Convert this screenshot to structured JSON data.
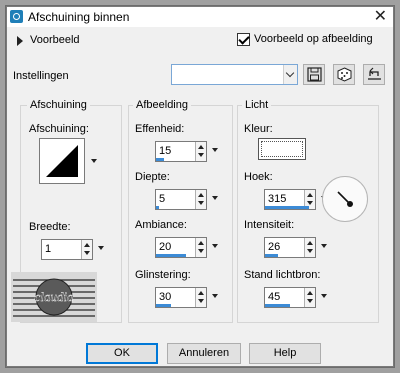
{
  "window": {
    "title": "Afschuining binnen",
    "close_symbol": "✕"
  },
  "preview": {
    "label": "Voorbeeld",
    "on_image_label": "Voorbeeld op afbeelding",
    "on_image_checked": true
  },
  "settings": {
    "label": "Instellingen",
    "value": ""
  },
  "bevel_group": {
    "title": "Afschuining",
    "shape_label": "Afschuining:",
    "width_label": "Breedte:",
    "width_value": "1"
  },
  "image_group": {
    "title": "Afbeelding",
    "smoothness": {
      "label": "Effenheid:",
      "value": "15",
      "level": 0.15
    },
    "depth": {
      "label": "Diepte:",
      "value": "5",
      "level": 0.05
    },
    "ambience": {
      "label": "Ambiance:",
      "value": "20",
      "level": 0.6
    },
    "shininess": {
      "label": "Glinstering:",
      "value": "30",
      "level": 0.3
    }
  },
  "light_group": {
    "title": "Licht",
    "color_label": "Kleur:",
    "color_value": "#ffffff",
    "angle": {
      "label": "Hoek:",
      "value": "315",
      "level": 0.875
    },
    "intensity": {
      "label": "Intensiteit:",
      "value": "26",
      "level": 0.26
    },
    "elevation": {
      "label": "Stand lichtbron:",
      "value": "45",
      "level": 0.5
    }
  },
  "watermark_text": "claudia",
  "buttons": {
    "ok": "OK",
    "cancel": "Annuleren",
    "help": "Help"
  },
  "icons": {
    "app": "app-icon",
    "save": "save-icon",
    "random": "dice-icon",
    "reset": "reset-icon",
    "dial": "angle-dial-icon"
  },
  "colors": {
    "accent": "#3c8bd6",
    "focus": "#0078d7",
    "dialog_bg": "#f0f0f0"
  }
}
